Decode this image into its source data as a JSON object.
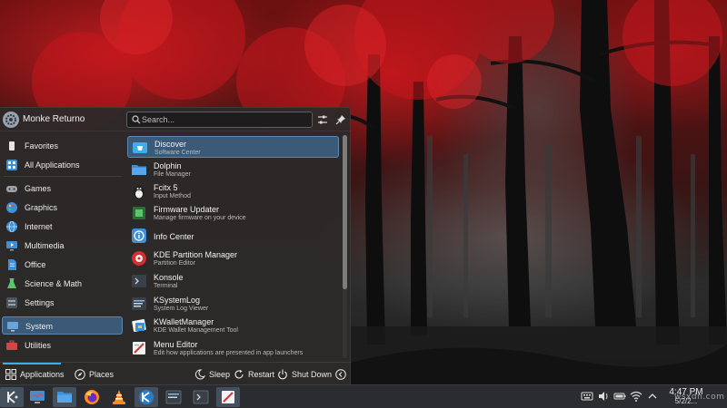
{
  "user": {
    "name": "Monke Returno"
  },
  "search": {
    "placeholder": "Search..."
  },
  "sidebar": {
    "items": [
      {
        "label": "Favorites"
      },
      {
        "label": "All Applications"
      },
      {
        "label": "Games"
      },
      {
        "label": "Graphics"
      },
      {
        "label": "Internet"
      },
      {
        "label": "Multimedia"
      },
      {
        "label": "Office"
      },
      {
        "label": "Science & Math"
      },
      {
        "label": "Settings"
      },
      {
        "label": "System"
      },
      {
        "label": "Utilities"
      }
    ],
    "selected": "System"
  },
  "apps": [
    {
      "name": "Discover",
      "subtitle": "Software Center",
      "icon": "discover-icon"
    },
    {
      "name": "Dolphin",
      "subtitle": "File Manager",
      "icon": "folder-icon"
    },
    {
      "name": "Fcitx 5",
      "subtitle": "Input Method",
      "icon": "penguin-icon"
    },
    {
      "name": "Firmware Updater",
      "subtitle": "Manage firmware on your device",
      "icon": "chip-icon"
    },
    {
      "name": "Info Center",
      "subtitle": "",
      "icon": "info-icon"
    },
    {
      "name": "KDE Partition Manager",
      "subtitle": "Partition Editor",
      "icon": "partition-icon"
    },
    {
      "name": "Konsole",
      "subtitle": "Terminal",
      "icon": "terminal-icon"
    },
    {
      "name": "KSystemLog",
      "subtitle": "System Log Viewer",
      "icon": "log-icon"
    },
    {
      "name": "KWalletManager",
      "subtitle": "KDE Wallet Management Tool",
      "icon": "wallet-icon"
    },
    {
      "name": "Menu Editor",
      "subtitle": "Edit how applications are presented in app launchers",
      "icon": "menu-editor-icon"
    }
  ],
  "footer": {
    "applications": "Applications",
    "places": "Places",
    "sleep": "Sleep",
    "restart": "Restart",
    "shutdown": "Shut Down"
  },
  "clock": {
    "time": "4:47 PM",
    "date": "5/2/2..."
  },
  "watermark": "wsxdn.com",
  "colors": {
    "accent": "#3daee9",
    "selection": "#3b5a78",
    "panel": "#2a2c30",
    "launcher_bg": "#2d2929"
  }
}
